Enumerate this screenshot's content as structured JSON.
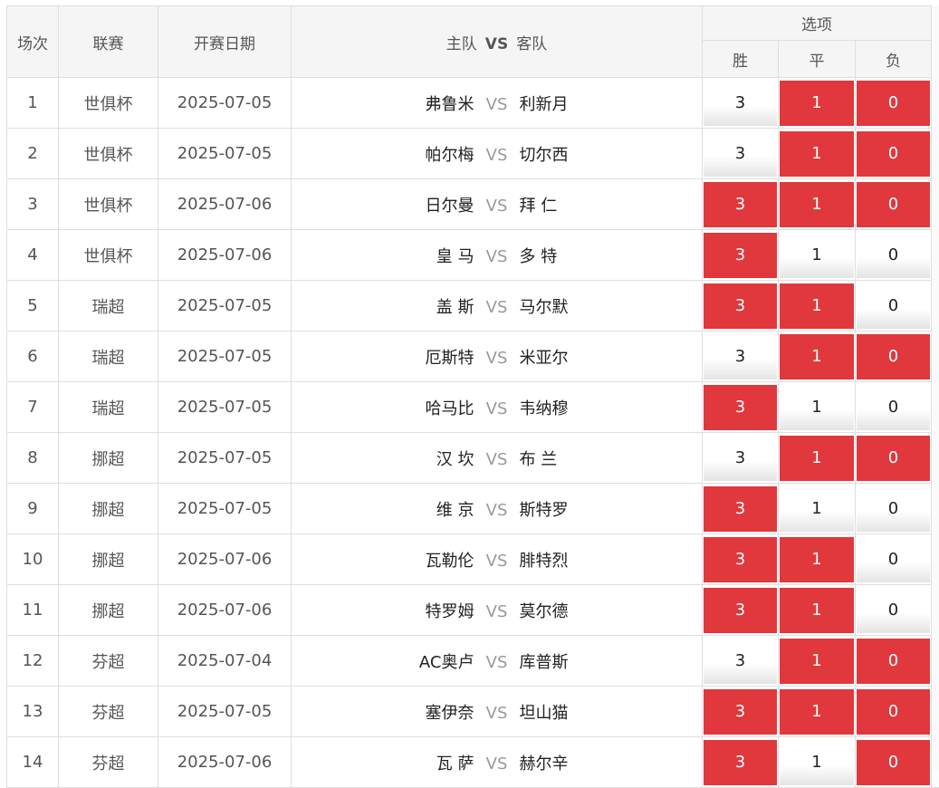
{
  "header": {
    "col_round": "场次",
    "col_league": "联赛",
    "col_date": "开赛日期",
    "col_home": "主队",
    "col_vs": "VS",
    "col_away": "客队",
    "col_options": "选项",
    "opt_win": "胜",
    "opt_draw": "平",
    "opt_loss": "负"
  },
  "matches": [
    {
      "no": "1",
      "league": "世俱杯",
      "date": "2025-07-05",
      "home": "弗鲁米",
      "away": "利新月",
      "vs": "VS",
      "w": "3",
      "d": "1",
      "l": "0"
    },
    {
      "no": "2",
      "league": "世俱杯",
      "date": "2025-07-05",
      "home": "帕尔梅",
      "away": "切尔西",
      "vs": "VS",
      "w": "3",
      "d": "1",
      "l": "0"
    },
    {
      "no": "3",
      "league": "世俱杯",
      "date": "2025-07-06",
      "home": "日尔曼",
      "away": "拜 仁",
      "vs": "VS",
      "w": "3",
      "d": "1",
      "l": "0"
    },
    {
      "no": "4",
      "league": "世俱杯",
      "date": "2025-07-06",
      "home": "皇 马",
      "away": "多 特",
      "vs": "VS",
      "w": "3",
      "d": "1",
      "l": "0"
    },
    {
      "no": "5",
      "league": "瑞超",
      "date": "2025-07-05",
      "home": "盖 斯",
      "away": "马尔默",
      "vs": "VS",
      "w": "3",
      "d": "1",
      "l": "0"
    },
    {
      "no": "6",
      "league": "瑞超",
      "date": "2025-07-05",
      "home": "厄斯特",
      "away": "米亚尔",
      "vs": "VS",
      "w": "3",
      "d": "1",
      "l": "0"
    },
    {
      "no": "7",
      "league": "瑞超",
      "date": "2025-07-05",
      "home": "哈马比",
      "away": "韦纳穆",
      "vs": "VS",
      "w": "3",
      "d": "1",
      "l": "0"
    },
    {
      "no": "8",
      "league": "挪超",
      "date": "2025-07-05",
      "home": "汉 坎",
      "away": "布 兰",
      "vs": "VS",
      "w": "3",
      "d": "1",
      "l": "0"
    },
    {
      "no": "9",
      "league": "挪超",
      "date": "2025-07-05",
      "home": "维 京",
      "away": "斯特罗",
      "vs": "VS",
      "w": "3",
      "d": "1",
      "l": "0"
    },
    {
      "no": "10",
      "league": "挪超",
      "date": "2025-07-06",
      "home": "瓦勒伦",
      "away": "腓特烈",
      "vs": "VS",
      "w": "3",
      "d": "1",
      "l": "0"
    },
    {
      "no": "11",
      "league": "挪超",
      "date": "2025-07-06",
      "home": "特罗姆",
      "away": "莫尔德",
      "vs": "VS",
      "w": "3",
      "d": "1",
      "l": "0"
    },
    {
      "no": "12",
      "league": "芬超",
      "date": "2025-07-04",
      "home": "AC奥卢",
      "away": "库普斯",
      "vs": "VS",
      "w": "3",
      "d": "1",
      "l": "0"
    },
    {
      "no": "13",
      "league": "芬超",
      "date": "2025-07-05",
      "home": "塞伊奈",
      "away": "坦山猫",
      "vs": "VS",
      "w": "3",
      "d": "1",
      "l": "0"
    },
    {
      "no": "14",
      "league": "芬超",
      "date": "2025-07-06",
      "home": "瓦 萨",
      "away": "赫尔辛",
      "vs": "VS",
      "w": "3",
      "d": "1",
      "l": "0"
    }
  ],
  "selections": [
    {
      "w": false,
      "d": true,
      "l": true
    },
    {
      "w": false,
      "d": true,
      "l": true
    },
    {
      "w": true,
      "d": true,
      "l": true
    },
    {
      "w": true,
      "d": false,
      "l": false
    },
    {
      "w": true,
      "d": true,
      "l": false
    },
    {
      "w": false,
      "d": true,
      "l": true
    },
    {
      "w": true,
      "d": false,
      "l": false
    },
    {
      "w": false,
      "d": true,
      "l": true
    },
    {
      "w": true,
      "d": false,
      "l": false
    },
    {
      "w": true,
      "d": true,
      "l": false
    },
    {
      "w": true,
      "d": true,
      "l": false
    },
    {
      "w": false,
      "d": true,
      "l": true
    },
    {
      "w": true,
      "d": true,
      "l": true
    },
    {
      "w": true,
      "d": false,
      "l": true
    }
  ],
  "colors": {
    "selected": "#e0383c",
    "header_bg": "#f5f5f5",
    "border": "#dedede"
  }
}
